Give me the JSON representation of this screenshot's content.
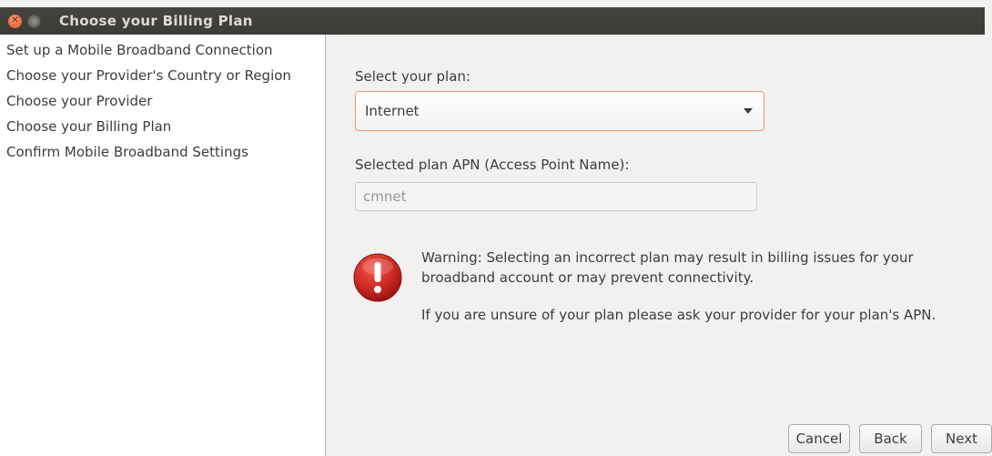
{
  "window": {
    "title": "Choose your Billing Plan"
  },
  "sidebar": {
    "steps": [
      {
        "label": "Set up a Mobile Broadband Connection"
      },
      {
        "label": "Choose your Provider's Country or Region"
      },
      {
        "label": "Choose your Provider"
      },
      {
        "label": "Choose your Billing Plan"
      },
      {
        "label": "Confirm Mobile Broadband Settings"
      }
    ]
  },
  "main": {
    "plan_label": "Select your plan:",
    "plan_selected": "Internet",
    "apn_label": "Selected plan APN (Access Point Name):",
    "apn_value": "cmnet",
    "warning_text": "Warning: Selecting an incorrect plan may result in billing issues for your broadband account or may prevent connectivity.",
    "hint_text": "If you are unsure of your plan please ask your provider for your plan's APN."
  },
  "buttons": {
    "cancel": "Cancel",
    "back": "Back",
    "next": "Next"
  },
  "colors": {
    "titlebar": "#3c3b37",
    "close_button": "#e8541d",
    "combo_focus_border": "#e59a73",
    "warning_icon": "#c9211e"
  },
  "icons": {
    "close": "close-icon",
    "minimize": "minimize-icon",
    "warning": "warning-icon",
    "dropdown": "chevron-down-icon"
  }
}
